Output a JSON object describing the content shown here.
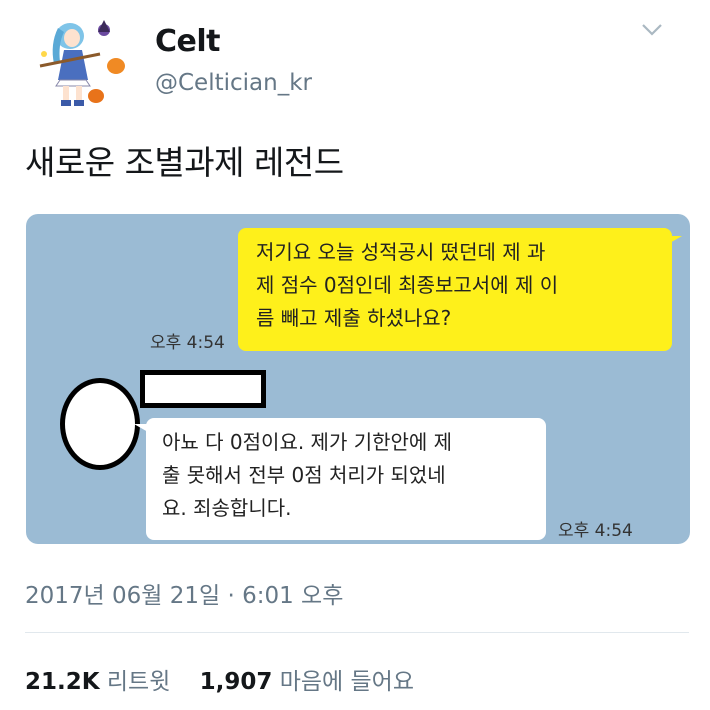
{
  "tweet": {
    "user": {
      "name": "Celt",
      "handle": "@Celtician_kr"
    },
    "text": "새로운 조별과제 레전드",
    "timestamp": "2017년 06월 21일 · 6:01 오후",
    "retweets": {
      "count": "21.2K",
      "label": "리트윗"
    },
    "likes": {
      "count": "1,907",
      "label": "마음에 들어요"
    },
    "menu_icon": "chevron-down-icon",
    "avatar_icon": "anime-witch-character"
  },
  "chat": {
    "outgoing": {
      "text": "저기요 오늘 성적공시 떴던데 제 과\n제 점수 0점인데 최종보고서에 제 이\n름 빼고 제출 하셨나요?",
      "time": "오후 4:54"
    },
    "incoming": {
      "text": "아뇨 다 0점이요. 제가 기한안에 제\n출 못해서 전부 0점 처리가 되었네\n요. 죄송합니다.",
      "time": "오후 4:54"
    },
    "colors": {
      "background": "#9bbbd4",
      "outgoing_bubble": "#fef01b",
      "incoming_bubble": "#ffffff"
    }
  }
}
